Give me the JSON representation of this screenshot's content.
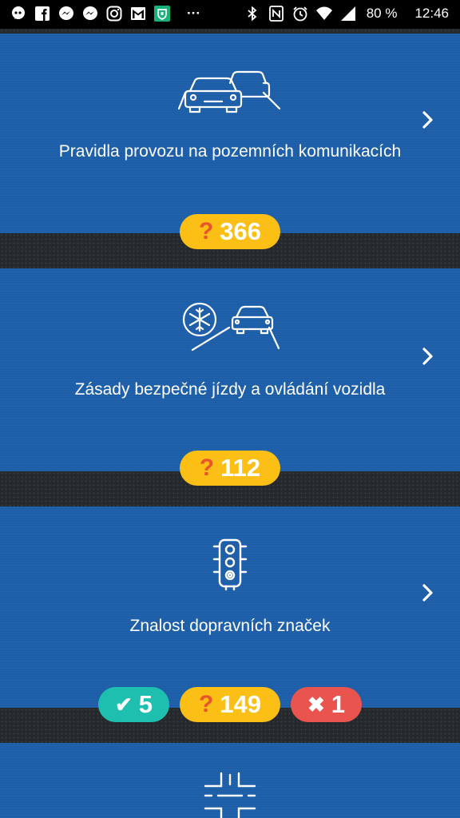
{
  "status_bar": {
    "icons": [
      "chat-bubble-icon",
      "facebook-icon",
      "messenger-icon",
      "messenger-icon",
      "instagram-icon",
      "gmail-icon",
      "app-shield-icon",
      "more-dots-icon",
      "bluetooth-icon",
      "nfc-icon",
      "alarm-icon",
      "wifi-icon",
      "signal-icon"
    ],
    "more": "···",
    "battery": "80 %",
    "time": "12:46"
  },
  "categories": [
    {
      "title": "Pravidla provozu na pozemních komunikacích",
      "icon": "cars-on-road-icon",
      "questions": "366"
    },
    {
      "title": "Zásady bezpečné jízdy a ovládání vozidla",
      "icon": "snowflake-car-icon",
      "questions": "112"
    },
    {
      "title": "Znalost dopravních značek",
      "icon": "traffic-light-icon",
      "correct": "5",
      "questions": "149",
      "wrong": "1"
    }
  ],
  "badge_symbols": {
    "question": "?",
    "correct": "✔",
    "wrong": "✖"
  },
  "colors": {
    "card": "#1d5ea8",
    "question_badge": "#fcbf15",
    "correct_badge": "#1fbfb0",
    "wrong_badge": "#e9544f"
  }
}
